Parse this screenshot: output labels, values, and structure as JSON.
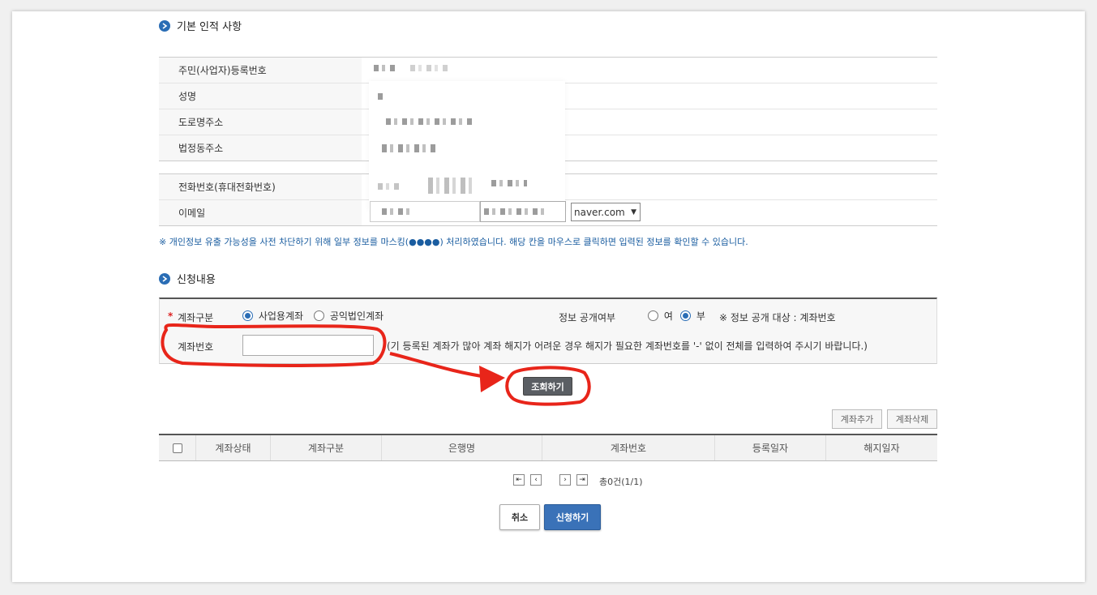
{
  "basic": {
    "title": "기본 인적 사항",
    "rows": [
      {
        "label": "주민(사업자)등록번호"
      },
      {
        "label": "성명"
      },
      {
        "label": "도로명주소"
      },
      {
        "label": "법정동주소"
      }
    ],
    "contact_rows": [
      {
        "label": "전화번호(휴대전화번호)"
      },
      {
        "label": "이메일"
      }
    ],
    "email_domain": "naver.com",
    "note": "※ 개인정보 유출 가능성을 사전 차단하기 위해 일부 정보를 마스킹(●●●●) 처리하였습니다. 해당 칸을 마우스로 클릭하면 입력된 정보를 확인할 수 있습니다."
  },
  "request": {
    "title": "신청내용",
    "required_mark": "*",
    "account_type_label": "계좌구분",
    "account_type_options": [
      "사업용계좌",
      "공익법인계좌"
    ],
    "account_type_selected": "사업용계좌",
    "disclosure_label": "정보 공개여부",
    "disclosure_options": [
      "여",
      "부"
    ],
    "disclosure_selected": "부",
    "disclosure_note": "※ 정보 공개 대상 : 계좌번호",
    "account_no_label": "계좌번호",
    "account_no_value": "",
    "account_no_hint": "(기 등록된 계좌가 많아 계좌 해지가 어려운 경우 해지가 필요한 계좌번호를 '-' 없이 전체를 입력하여 주시기 바랍니다.)",
    "search_button": "조회하기"
  },
  "accounts": {
    "add_button": "계좌추가",
    "delete_button": "계좌삭제",
    "columns": [
      "계좌상태",
      "계좌구분",
      "은행명",
      "계좌번호",
      "등록일자",
      "해지일자"
    ],
    "rows": [],
    "total": "총0건(1/1)"
  },
  "actions": {
    "cancel": "취소",
    "submit": "신청하기"
  },
  "colors": {
    "accent": "#2a6db5",
    "annotation": "#e8251a"
  }
}
